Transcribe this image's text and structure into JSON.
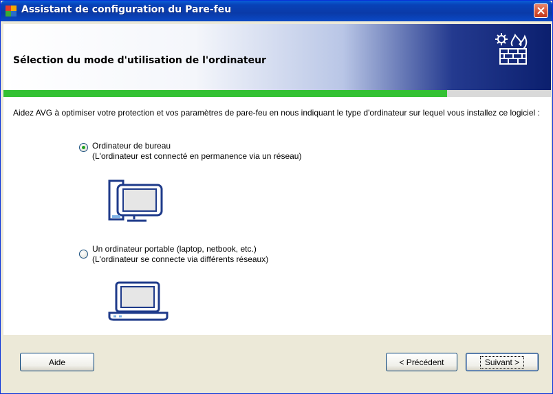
{
  "window": {
    "title": "Assistant de configuration du Pare-feu"
  },
  "header": {
    "title": "Sélection du mode d'utilisation de l'ordinateur",
    "icon": "firewall-gear-icon"
  },
  "progress": {
    "fraction": 0.81,
    "color": "#33c133"
  },
  "content": {
    "intro": "Aidez AVG à optimiser votre protection et vos paramètres de pare-feu en nous indiquant le type d'ordinateur sur lequel vous installez ce logiciel :",
    "options": [
      {
        "label": "Ordinateur de bureau",
        "description": "(L'ordinateur est connecté en permanence via un réseau)",
        "selected": true,
        "icon": "desktop-computer-icon"
      },
      {
        "label": "Un ordinateur portable (laptop, netbook, etc.)",
        "description": "(L'ordinateur se connecte via différents réseaux)",
        "selected": false,
        "icon": "laptop-icon"
      }
    ]
  },
  "footer": {
    "help_label": "Aide",
    "back_label": "< Précédent",
    "next_label": "Suivant >"
  }
}
